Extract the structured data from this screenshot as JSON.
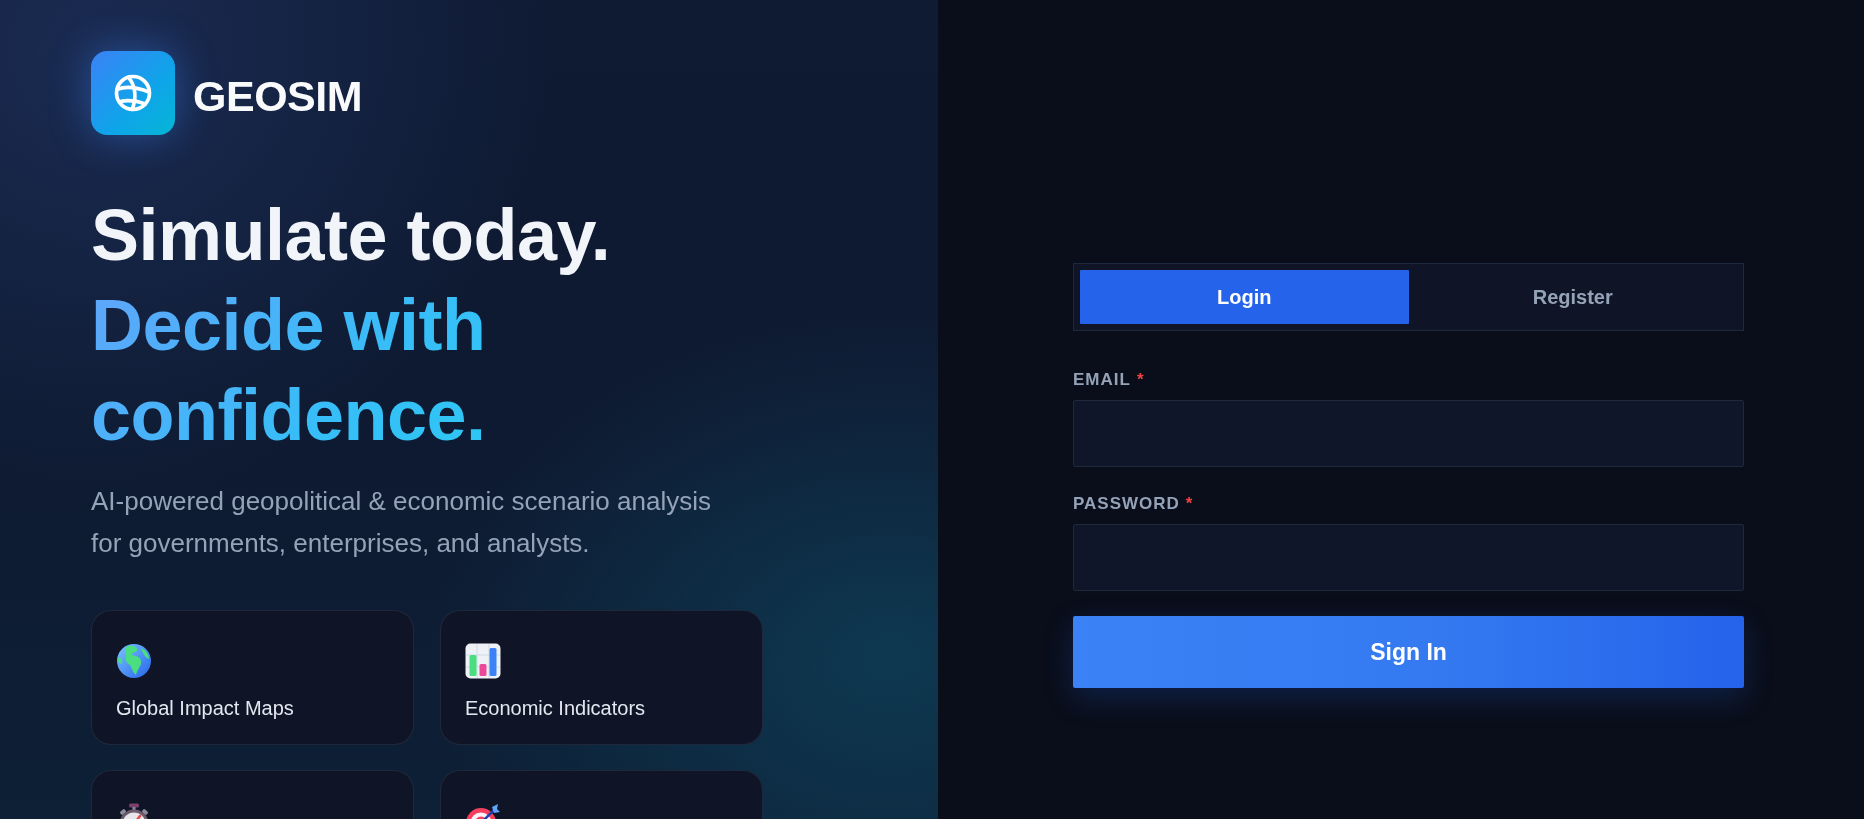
{
  "brand": {
    "name": "GEOSIM"
  },
  "hero": {
    "headline": "Simulate today.",
    "headline_accent": "Decide with confidence.",
    "subtitle": "AI-powered geopolitical & economic scenario analysis for governments, enterprises, and analysts."
  },
  "features": [
    {
      "kind": "globe",
      "label": "Global Impact Maps"
    },
    {
      "kind": "chart",
      "label": "Economic Indicators"
    },
    {
      "kind": "stopwatch"
    },
    {
      "kind": "target"
    }
  ],
  "auth": {
    "tabs": [
      {
        "label": "Login",
        "selected": true
      },
      {
        "label": "Register",
        "selected": false
      }
    ],
    "fields": [
      {
        "label": "EMAIL",
        "required_mark": "*"
      },
      {
        "label": "PASSWORD",
        "required_mark": "*"
      }
    ],
    "submit": "Sign In"
  }
}
